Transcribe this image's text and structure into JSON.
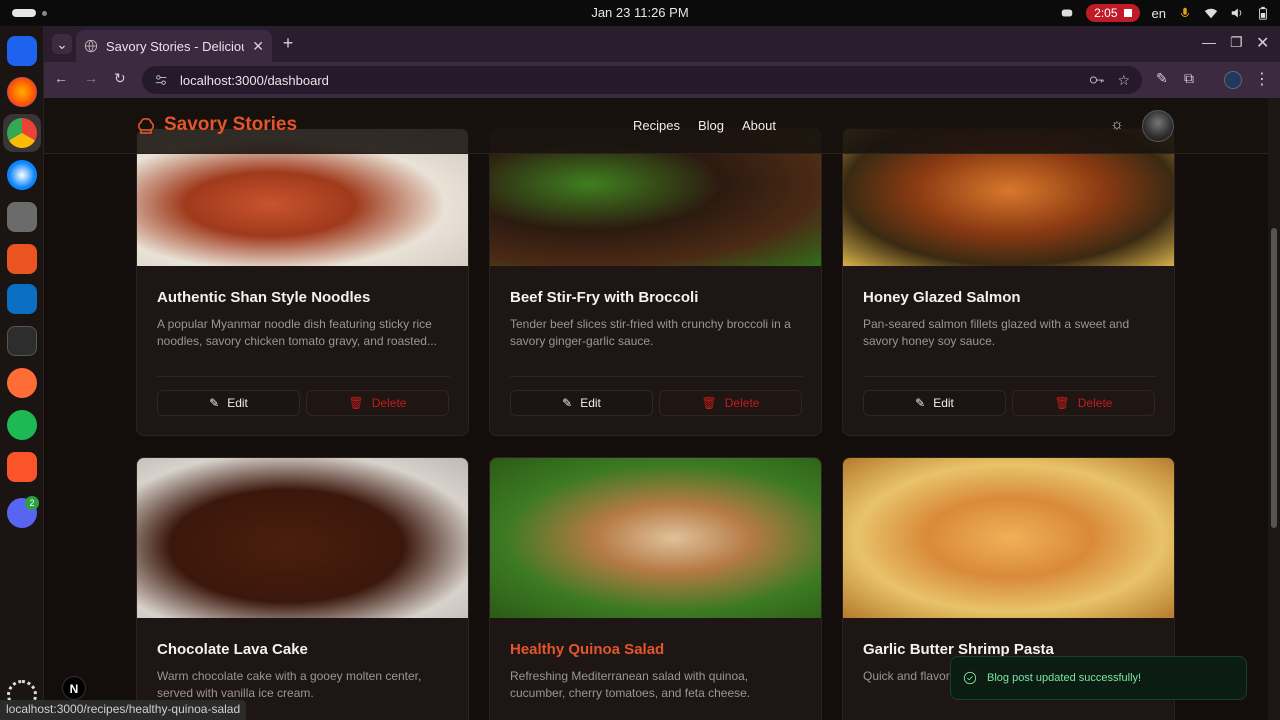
{
  "system": {
    "clock": "Jan 23  11:26 PM",
    "recording_time": "2:05",
    "language": "en",
    "colors": {
      "record": "#c01c28",
      "accent": "#e4552a"
    }
  },
  "dock": {
    "apps": [
      "docker-icon",
      "firefox-icon",
      "chrome-icon",
      "thunderbird-icon",
      "files-icon",
      "app-center-icon",
      "vscode-icon",
      "terminal-icon",
      "postman-icon",
      "spotify-icon",
      "brave-icon",
      "discord-icon",
      "apps-grid-icon"
    ],
    "discord_badge": "2"
  },
  "browser": {
    "tab_title": "Savory Stories - Delicious",
    "url": "localhost:3000/dashboard",
    "status_url": "localhost:3000/recipes/healthy-quinoa-salad"
  },
  "site": {
    "brand": "Savory Stories",
    "nav": [
      "Recipes",
      "Blog",
      "About"
    ]
  },
  "cards": [
    {
      "title": "Authentic Shan Style Noodles",
      "desc": "A popular Myanmar noodle dish featuring sticky rice noodles, savory chicken tomato gravy, and roasted...",
      "edit": "Edit",
      "delete": "Delete"
    },
    {
      "title": "Beef Stir-Fry with Broccoli",
      "desc": "Tender beef slices stir-fried with crunchy broccoli in a savory ginger-garlic sauce.",
      "edit": "Edit",
      "delete": "Delete"
    },
    {
      "title": "Honey Glazed Salmon",
      "desc": "Pan-seared salmon fillets glazed with a sweet and savory honey soy sauce.",
      "edit": "Edit",
      "delete": "Delete"
    },
    {
      "title": "Chocolate Lava Cake",
      "desc": "Warm chocolate cake with a gooey molten center, served with vanilla ice cream."
    },
    {
      "title": "Healthy Quinoa Salad",
      "desc": "Refreshing Mediterranean salad with quinoa, cucumber, cherry tomatoes, and feta cheese."
    },
    {
      "title": "Garlic Butter Shrimp Pasta",
      "desc": "Quick and flavor... sauce with fresh..."
    }
  ],
  "toast": {
    "message": "Blog post updated successfully!"
  },
  "next_badge": "N"
}
